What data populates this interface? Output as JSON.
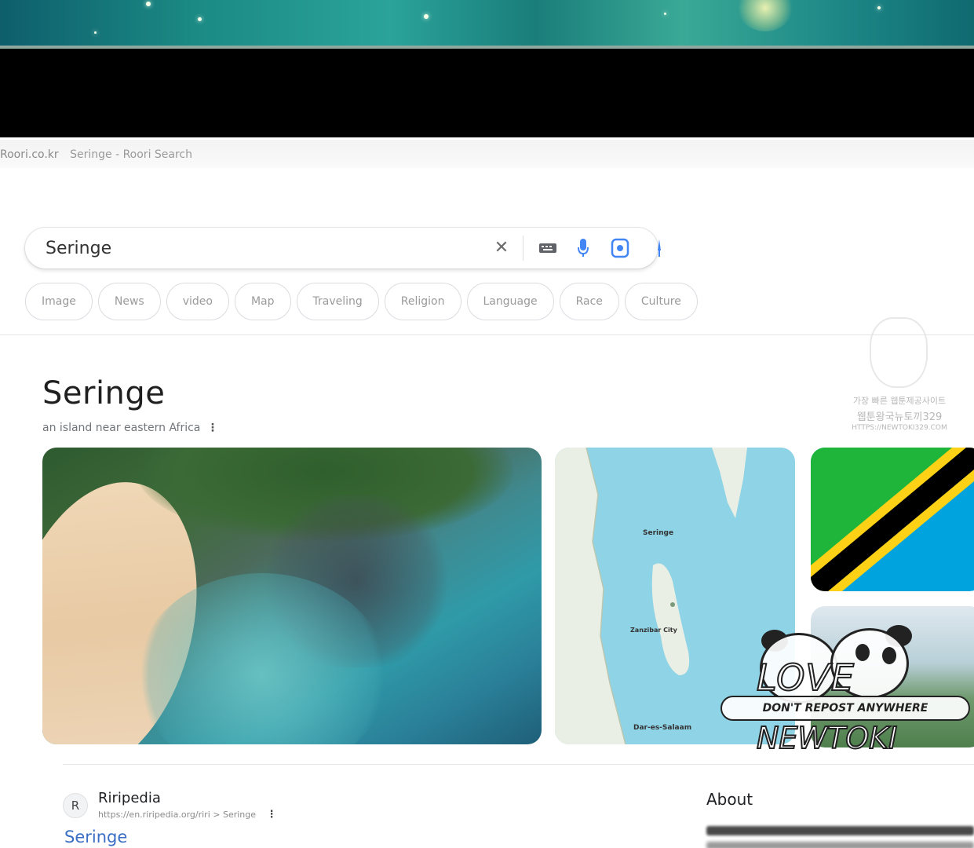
{
  "browser": {
    "domain": "Roori.co.kr",
    "tab_title": "Seringe - Roori Search"
  },
  "search": {
    "query": "Seringe",
    "icons": {
      "clear": "close-icon",
      "keyboard": "keyboard-icon",
      "voice": "microphone-icon",
      "lens": "lens-icon",
      "search": "search-icon"
    }
  },
  "chips": [
    "Image",
    "News",
    "video",
    "Map",
    "Traveling",
    "Religion",
    "Language",
    "Race",
    "Culture"
  ],
  "knowledge_panel": {
    "title": "Seringe",
    "subtitle": "an island near eastern Africa",
    "map_labels": {
      "island": "Seringe",
      "city": "Zanzibar City",
      "port": "Dar-es-Salaam"
    },
    "flag_colors": {
      "green": "#1eb53a",
      "blue": "#00a3dd",
      "yellow": "#fcd116",
      "black": "#000000"
    }
  },
  "watermarks": {
    "top_right": [
      "가장 빠른 웹툰제공사이트",
      "웹툰왕국뉴토끼329",
      "HTTPS://NEWTOKI329.COM"
    ],
    "love": "LOVE",
    "banner": "DON'T REPOST ANYWHERE",
    "brand": "NEWTOKI"
  },
  "result": {
    "favicon_letter": "R",
    "site_name": "Riripedia",
    "url": "https://en.riripedia.org/riri > Seringe",
    "title": "Seringe"
  },
  "about": {
    "title": "About"
  }
}
